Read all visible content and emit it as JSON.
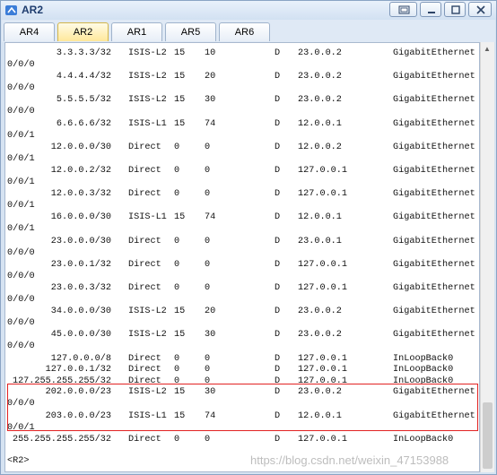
{
  "window": {
    "title": "AR2"
  },
  "tabs": [
    {
      "label": "AR4",
      "active": false
    },
    {
      "label": "AR2",
      "active": true
    },
    {
      "label": "AR1",
      "active": false
    },
    {
      "label": "AR5",
      "active": false
    },
    {
      "label": "AR6",
      "active": false
    }
  ],
  "routes": [
    {
      "dest": "3.3.3.3/32",
      "proto": "ISIS-L2",
      "pre": "15",
      "cost": "10",
      "flags": "D",
      "nexthop": "23.0.0.2",
      "iface": "GigabitEthernet",
      "iface2": "0/0/0"
    },
    {
      "dest": "4.4.4.4/32",
      "proto": "ISIS-L2",
      "pre": "15",
      "cost": "20",
      "flags": "D",
      "nexthop": "23.0.0.2",
      "iface": "GigabitEthernet",
      "iface2": "0/0/0"
    },
    {
      "dest": "5.5.5.5/32",
      "proto": "ISIS-L2",
      "pre": "15",
      "cost": "30",
      "flags": "D",
      "nexthop": "23.0.0.2",
      "iface": "GigabitEthernet",
      "iface2": "0/0/0"
    },
    {
      "dest": "6.6.6.6/32",
      "proto": "ISIS-L1",
      "pre": "15",
      "cost": "74",
      "flags": "D",
      "nexthop": "12.0.0.1",
      "iface": "GigabitEthernet",
      "iface2": "0/0/1"
    },
    {
      "dest": "12.0.0.0/30",
      "proto": "Direct",
      "pre": "0",
      "cost": "0",
      "flags": "D",
      "nexthop": "12.0.0.2",
      "iface": "GigabitEthernet",
      "iface2": "0/0/1"
    },
    {
      "dest": "12.0.0.2/32",
      "proto": "Direct",
      "pre": "0",
      "cost": "0",
      "flags": "D",
      "nexthop": "127.0.0.1",
      "iface": "GigabitEthernet",
      "iface2": "0/0/1"
    },
    {
      "dest": "12.0.0.3/32",
      "proto": "Direct",
      "pre": "0",
      "cost": "0",
      "flags": "D",
      "nexthop": "127.0.0.1",
      "iface": "GigabitEthernet",
      "iface2": "0/0/1"
    },
    {
      "dest": "16.0.0.0/30",
      "proto": "ISIS-L1",
      "pre": "15",
      "cost": "74",
      "flags": "D",
      "nexthop": "12.0.0.1",
      "iface": "GigabitEthernet",
      "iface2": "0/0/1"
    },
    {
      "dest": "23.0.0.0/30",
      "proto": "Direct",
      "pre": "0",
      "cost": "0",
      "flags": "D",
      "nexthop": "23.0.0.1",
      "iface": "GigabitEthernet",
      "iface2": "0/0/0"
    },
    {
      "dest": "23.0.0.1/32",
      "proto": "Direct",
      "pre": "0",
      "cost": "0",
      "flags": "D",
      "nexthop": "127.0.0.1",
      "iface": "GigabitEthernet",
      "iface2": "0/0/0"
    },
    {
      "dest": "23.0.0.3/32",
      "proto": "Direct",
      "pre": "0",
      "cost": "0",
      "flags": "D",
      "nexthop": "127.0.0.1",
      "iface": "GigabitEthernet",
      "iface2": "0/0/0"
    },
    {
      "dest": "34.0.0.0/30",
      "proto": "ISIS-L2",
      "pre": "15",
      "cost": "20",
      "flags": "D",
      "nexthop": "23.0.0.2",
      "iface": "GigabitEthernet",
      "iface2": "0/0/0"
    },
    {
      "dest": "45.0.0.0/30",
      "proto": "ISIS-L2",
      "pre": "15",
      "cost": "30",
      "flags": "D",
      "nexthop": "23.0.0.2",
      "iface": "GigabitEthernet",
      "iface2": "0/0/0"
    },
    {
      "dest": "127.0.0.0/8",
      "proto": "Direct",
      "pre": "0",
      "cost": "0",
      "flags": "D",
      "nexthop": "127.0.0.1",
      "iface": "InLoopBack0",
      "iface2": ""
    },
    {
      "dest": "127.0.0.1/32",
      "proto": "Direct",
      "pre": "0",
      "cost": "0",
      "flags": "D",
      "nexthop": "127.0.0.1",
      "iface": "InLoopBack0",
      "iface2": ""
    },
    {
      "dest": "127.255.255.255/32",
      "proto": "Direct",
      "pre": "0",
      "cost": "0",
      "flags": "D",
      "nexthop": "127.0.0.1",
      "iface": "InLoopBack0",
      "iface2": ""
    },
    {
      "dest": "202.0.0.0/23",
      "proto": "ISIS-L2",
      "pre": "15",
      "cost": "30",
      "flags": "D",
      "nexthop": "23.0.0.2",
      "iface": "GigabitEthernet",
      "iface2": "0/0/0"
    },
    {
      "dest": "203.0.0.0/23",
      "proto": "ISIS-L1",
      "pre": "15",
      "cost": "74",
      "flags": "D",
      "nexthop": "12.0.0.1",
      "iface": "GigabitEthernet",
      "iface2": "0/0/1"
    },
    {
      "dest": "255.255.255.255/32",
      "proto": "Direct",
      "pre": "0",
      "cost": "0",
      "flags": "D",
      "nexthop": "127.0.0.1",
      "iface": "InLoopBack0",
      "iface2": ""
    }
  ],
  "prompt": "<R2>",
  "watermark": "https://blog.csdn.net/weixin_47153988",
  "colors": {
    "highlight": "#e22323",
    "active_tab": "#ffe89a"
  }
}
